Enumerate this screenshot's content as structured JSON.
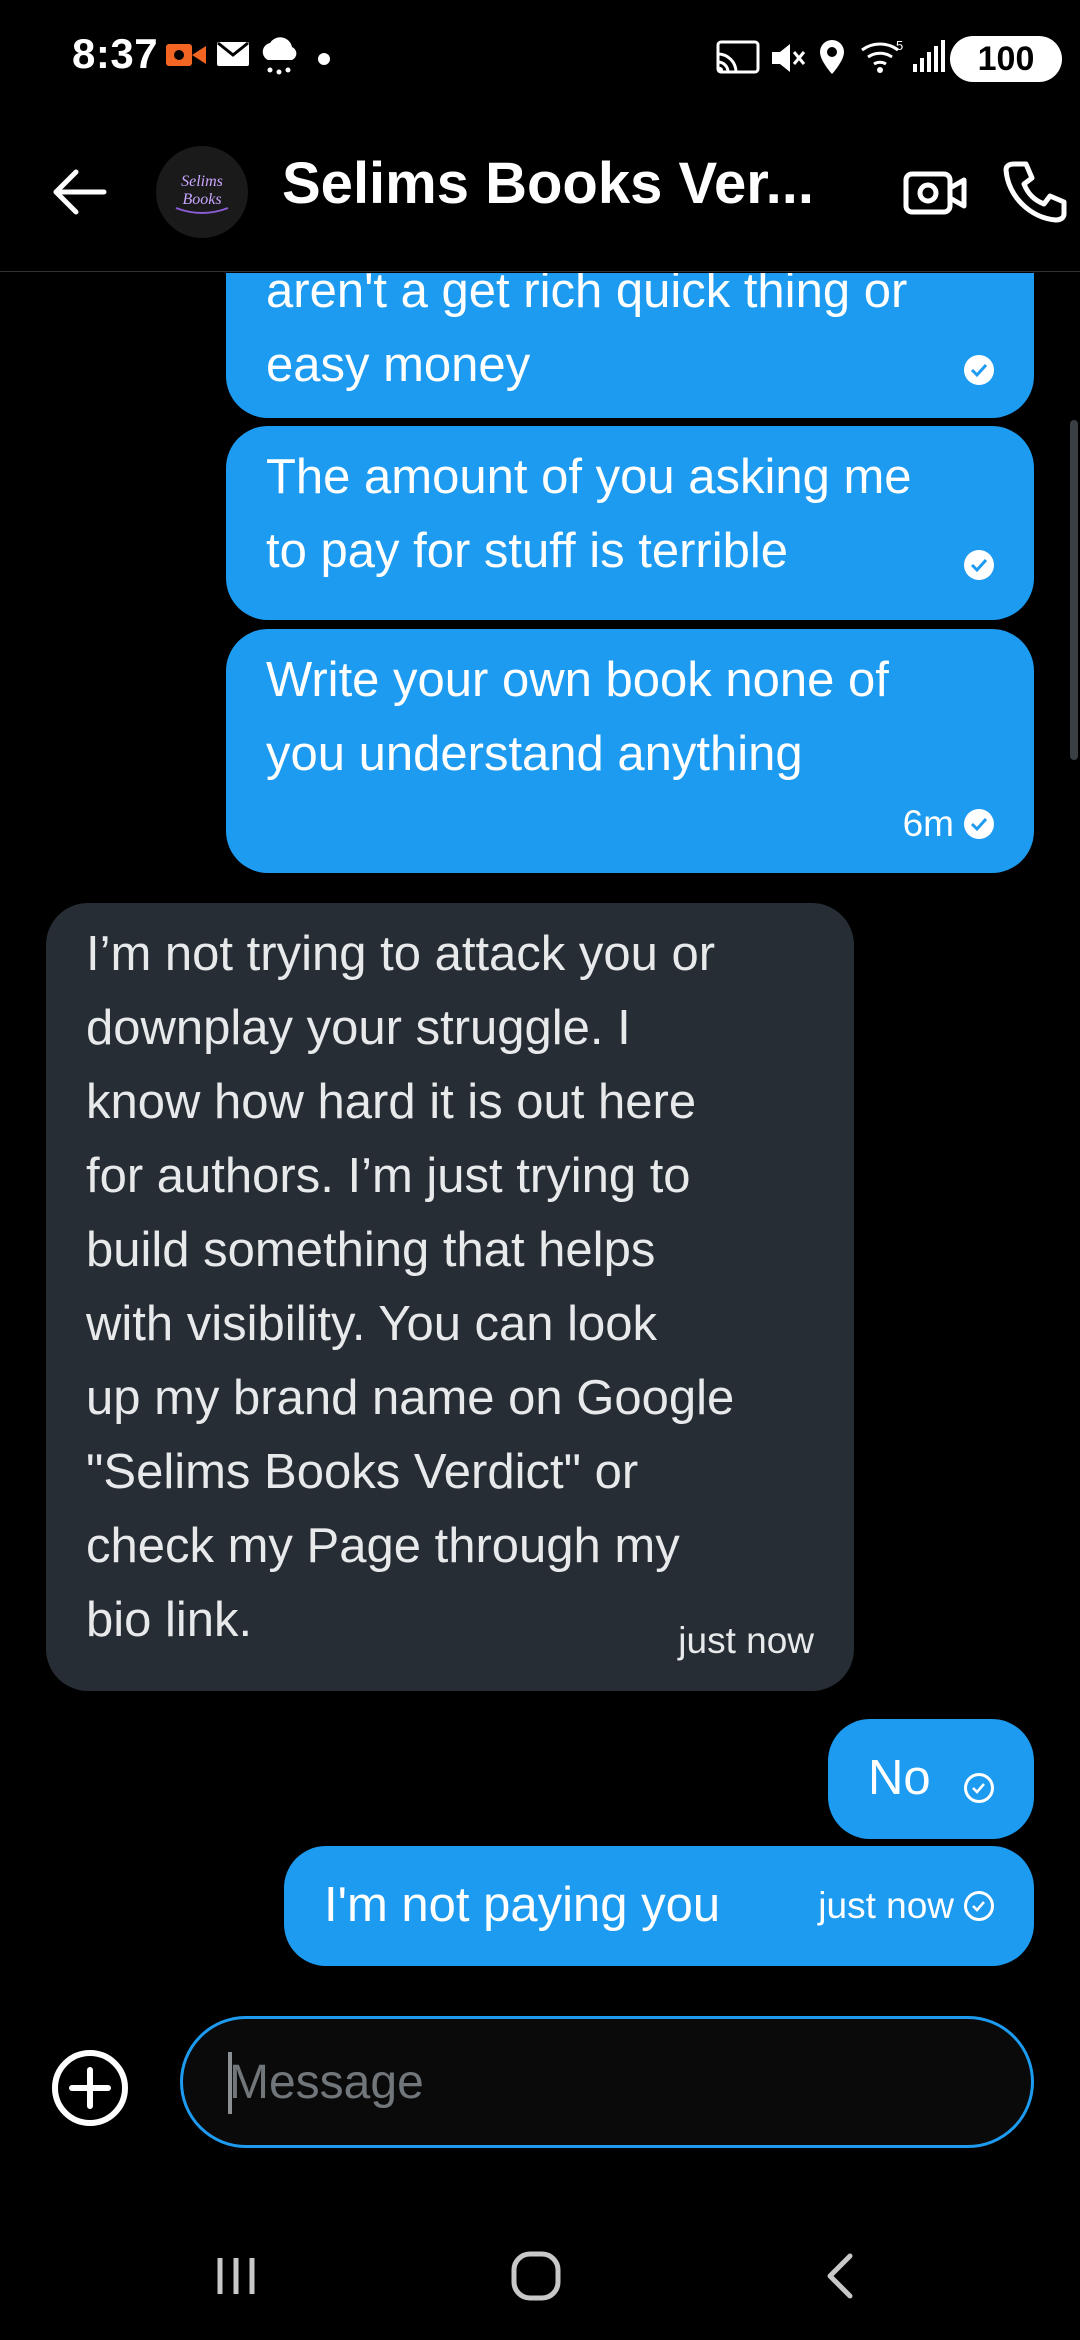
{
  "status_bar": {
    "time": "8:37",
    "battery": "100",
    "icons": [
      "video-record-icon",
      "mail-icon",
      "cloud-icon",
      "dot-icon",
      "cast-icon",
      "mute-icon",
      "location-icon",
      "wifi-icon",
      "signal-icon",
      "battery-icon"
    ]
  },
  "header": {
    "title": "Selims Books Ver...",
    "avatar_text_line1": "Selims",
    "avatar_text_line2": "Books",
    "back_icon": "arrow-left-icon",
    "video_icon": "video-camera-icon",
    "call_icon": "phone-icon"
  },
  "messages": [
    {
      "direction": "outgoing",
      "lines": [
        "aren't a get rich quick thing or",
        "easy money"
      ],
      "time": "",
      "status": "sent-check-filled"
    },
    {
      "direction": "outgoing",
      "lines": [
        "The amount of you asking me",
        "to pay for stuff is terrible"
      ],
      "time": "",
      "status": "sent-check-filled"
    },
    {
      "direction": "outgoing",
      "lines": [
        "Write your own book none of",
        "you understand anything"
      ],
      "time": "6m",
      "status": "sent-check-filled"
    },
    {
      "direction": "incoming",
      "lines": [
        "I’m not trying to attack you or",
        "downplay your struggle. I",
        "know how hard it is out here",
        "for authors. I’m just trying to",
        "build something that helps",
        "with visibility. You can look",
        "up my brand name on Google",
        "\"Selims Books Verdict\" or",
        "check my Page through my",
        "bio link."
      ],
      "time": "just now"
    },
    {
      "direction": "outgoing",
      "lines": [
        "No"
      ],
      "time": "",
      "status": "sent-check-outline"
    },
    {
      "direction": "outgoing",
      "lines": [
        "I'm not paying you"
      ],
      "time": "just now",
      "status": "sent-check-outline"
    }
  ],
  "composer": {
    "placeholder": "Message",
    "add_icon": "plus-circle-icon"
  },
  "nav": {
    "icons": [
      "recent-apps-icon",
      "home-icon",
      "back-icon"
    ]
  },
  "colors": {
    "background": "#000000",
    "outgoing_bubble": "#1d9bf0",
    "incoming_bubble": "#262d34",
    "accent": "#1d9bf0",
    "recording_orange": "#f26522"
  }
}
